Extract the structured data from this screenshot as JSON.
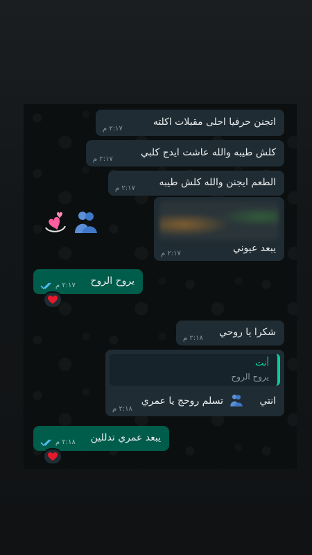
{
  "colors": {
    "incoming_bubble": "#202c33",
    "outgoing_bubble": "#005c4b",
    "chat_background": "#0b0f10",
    "read_ticks": "#53bdeb",
    "quote_accent": "#06cf9c"
  },
  "messages": [
    {
      "direction": "in",
      "text": "اتجنن حرفيا احلى مقبلات اكلته",
      "time": "٢:١٧ م"
    },
    {
      "direction": "in",
      "text": "كلش طيبه والله عاشت ايدج كلبي",
      "time": "٢:١٧ م"
    },
    {
      "direction": "in",
      "text": "الطعم ايجنن والله كلش طيبه",
      "time": "٢:١٧ م"
    },
    {
      "direction": "in",
      "type": "image",
      "caption": "يبعد عيوني",
      "time": "٢:١٧ م",
      "image_icon": "blurred-photo"
    },
    {
      "direction": "out",
      "text": "يروح الروح",
      "time": "٢:١٧ م",
      "status_icon": "double-check-read-icon",
      "reaction": "red-heart"
    },
    {
      "direction": "in",
      "text": "شكرا يا روحي",
      "time": "٢:١٨ م"
    },
    {
      "direction": "in",
      "reply_to": {
        "author": "أنت",
        "text": "يروح الروح"
      },
      "text": "تسلم روحج يا عمري",
      "text_after_emoji": "انتي",
      "inline_emoji": "people-hugging",
      "time": "٢:١٨ م"
    },
    {
      "direction": "out",
      "text": "يبعد عمري تدللين",
      "time": "٢:١٨ م",
      "status_icon": "double-check-read-icon",
      "reaction": "red-heart"
    }
  ],
  "sent_stickers": [
    "people-hugging-emoji",
    "revolving-hearts-emoji"
  ]
}
